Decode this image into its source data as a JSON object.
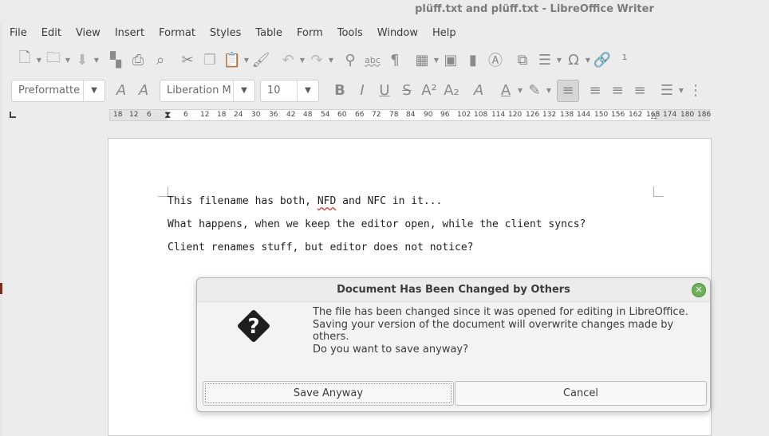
{
  "window": {
    "title": "plüff.txt and plüff.txt - LibreOffice Writer"
  },
  "menubar": [
    "File",
    "Edit",
    "View",
    "Insert",
    "Format",
    "Styles",
    "Table",
    "Form",
    "Tools",
    "Window",
    "Help"
  ],
  "formatting": {
    "paragraph_style": "Preformatte",
    "font_name": "Liberation M",
    "font_size": "10"
  },
  "ruler": {
    "ticks": [
      "18",
      "12",
      "6",
      "6",
      "12",
      "18",
      "24",
      "30",
      "36",
      "42",
      "48",
      "54",
      "60",
      "66",
      "72",
      "78",
      "84",
      "90",
      "96",
      "102",
      "108",
      "114",
      "120",
      "126",
      "132",
      "138",
      "144",
      "150",
      "156",
      "162",
      "168",
      "174",
      "180",
      "186"
    ]
  },
  "document": {
    "lines": [
      "This filename has both, NFD and NFC in it...",
      "What happens, when we keep the editor open, while the client syncs?",
      "Client renames stuff, but editor does not notice?"
    ]
  },
  "dialog": {
    "title": "Document Has Been Changed by Others",
    "message_line1": "The file has been changed since it was opened for editing in LibreOffice.",
    "message_line2": "Saving your version of the document will overwrite changes made by others.",
    "question": "Do you want to save anyway?",
    "save_label": "Save Anyway",
    "cancel_label": "Cancel"
  },
  "icons": [
    "new-document-icon",
    "open-folder-icon",
    "save-icon",
    "export-pdf-icon",
    "print-icon",
    "print-preview-icon",
    "cut-icon",
    "copy-icon",
    "paste-icon",
    "clone-formatting-icon",
    "undo-icon",
    "redo-icon",
    "find-replace-icon",
    "spelling-icon",
    "formatting-marks-icon",
    "insert-table-icon",
    "insert-image-icon",
    "insert-chart-icon",
    "insert-textbox-icon",
    "page-break-icon",
    "insert-field-icon",
    "special-character-icon",
    "hyperlink-icon",
    "footnote-icon",
    "help-icon"
  ],
  "colors": {
    "accent_close": "#6bb25a",
    "spell_error": "#dd3333"
  }
}
